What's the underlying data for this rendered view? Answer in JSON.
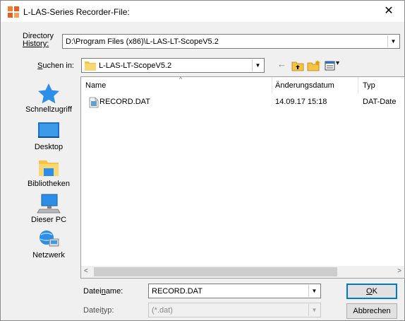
{
  "window": {
    "title": "L-LAS-Series Recorder-File:",
    "close_glyph": "✕"
  },
  "history": {
    "label_line1": "Directory",
    "label_line2": "History:",
    "value": "D:\\Program Files (x86)\\L-LAS-LT-ScopeV5.2"
  },
  "lookin": {
    "label_pre": "S",
    "label_rest": "uchen in:",
    "value": "L-LAS-LT-ScopeV5.2"
  },
  "toolbar": {
    "back_glyph": "←",
    "view_arrow_glyph": "▾"
  },
  "places": [
    {
      "label": "Schnellzugriff",
      "icon": "star-icon"
    },
    {
      "label": "Desktop",
      "icon": "desktop-icon"
    },
    {
      "label": "Bibliotheken",
      "icon": "library-icon"
    },
    {
      "label": "Dieser PC",
      "icon": "computer-icon"
    },
    {
      "label": "Netzwerk",
      "icon": "network-icon"
    }
  ],
  "columns": {
    "name": "Name",
    "date": "Änderungsdatum",
    "type": "Typ"
  },
  "files": [
    {
      "name": "RECORD.DAT",
      "date": "14.09.17 15:18",
      "type": "DAT-Date"
    }
  ],
  "scroll": {
    "left_glyph": "<",
    "right_glyph": ">"
  },
  "filename": {
    "label_pre": "Datei",
    "label_u": "n",
    "label_post": "ame:",
    "value": "RECORD.DAT"
  },
  "filetype": {
    "label_pre": "Datei",
    "label_u": "t",
    "label_post": "yp:",
    "value": "(*.dat)"
  },
  "buttons": {
    "ok_u": "O",
    "ok_rest": "K",
    "cancel": "Abbrechen"
  },
  "colors": {
    "accent": "#0078d7",
    "folder": "#f6c342",
    "app_icon": "#f08030"
  }
}
